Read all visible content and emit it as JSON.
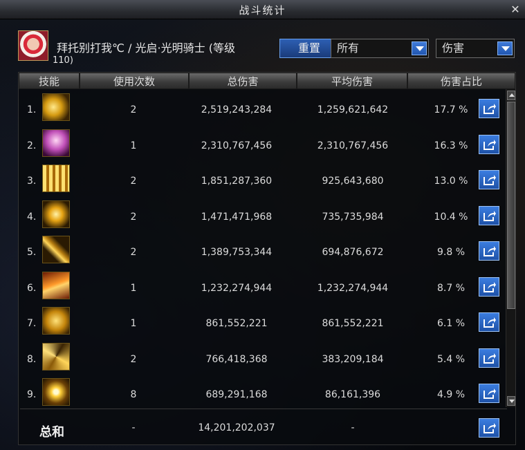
{
  "window": {
    "title": "战斗统计",
    "close_glyph": "✕"
  },
  "character": {
    "name": "拜托别打我℃ / 光启·光明骑士 (等级",
    "level": "110)"
  },
  "controls": {
    "reset_label": "重置",
    "filter_all": "所有",
    "filter_damage": "伤害"
  },
  "columns": [
    "技能",
    "使用次数",
    "总伤害",
    "平均伤害",
    "伤害占比"
  ],
  "rows": [
    {
      "rank": "1.",
      "uses": "2",
      "total": "2,519,243,284",
      "avg": "1,259,621,642",
      "pct": "17.7 %",
      "icon": "skill-icon-golden-lance"
    },
    {
      "rank": "2.",
      "uses": "1",
      "total": "2,310,767,456",
      "avg": "2,310,767,456",
      "pct": "16.3 %",
      "icon": "skill-icon-holy-maiden"
    },
    {
      "rank": "3.",
      "uses": "2",
      "total": "1,851,287,360",
      "avg": "925,643,680",
      "pct": "13.0 %",
      "icon": "skill-icon-light-pillars"
    },
    {
      "rank": "4.",
      "uses": "2",
      "total": "1,471,471,968",
      "avg": "735,735,984",
      "pct": "10.4 %",
      "icon": "skill-icon-radiant-slash"
    },
    {
      "rank": "5.",
      "uses": "2",
      "total": "1,389,753,344",
      "avg": "694,876,672",
      "pct": "9.8 %",
      "icon": "skill-icon-sword-cross"
    },
    {
      "rank": "6.",
      "uses": "1",
      "total": "1,232,274,944",
      "avg": "1,232,274,944",
      "pct": "8.7 %",
      "icon": "skill-icon-flame-wave"
    },
    {
      "rank": "7.",
      "uses": "1",
      "total": "861,552,221",
      "avg": "861,552,221",
      "pct": "6.1 %",
      "icon": "skill-icon-golden-crest"
    },
    {
      "rank": "8.",
      "uses": "2",
      "total": "766,418,368",
      "avg": "383,209,184",
      "pct": "5.4 %",
      "icon": "skill-icon-spiral-strike"
    },
    {
      "rank": "9.",
      "uses": "8",
      "total": "689,291,168",
      "avg": "86,161,396",
      "pct": "4.9 %",
      "icon": "skill-icon-starburst"
    }
  ],
  "total": {
    "label": "总和",
    "uses": "-",
    "total": "14,201,202,037",
    "avg": "-"
  },
  "colors": {
    "accent_blue": "#2d5fb3",
    "skill_gold": "#e0a91c",
    "text": "#dcdcdc"
  }
}
